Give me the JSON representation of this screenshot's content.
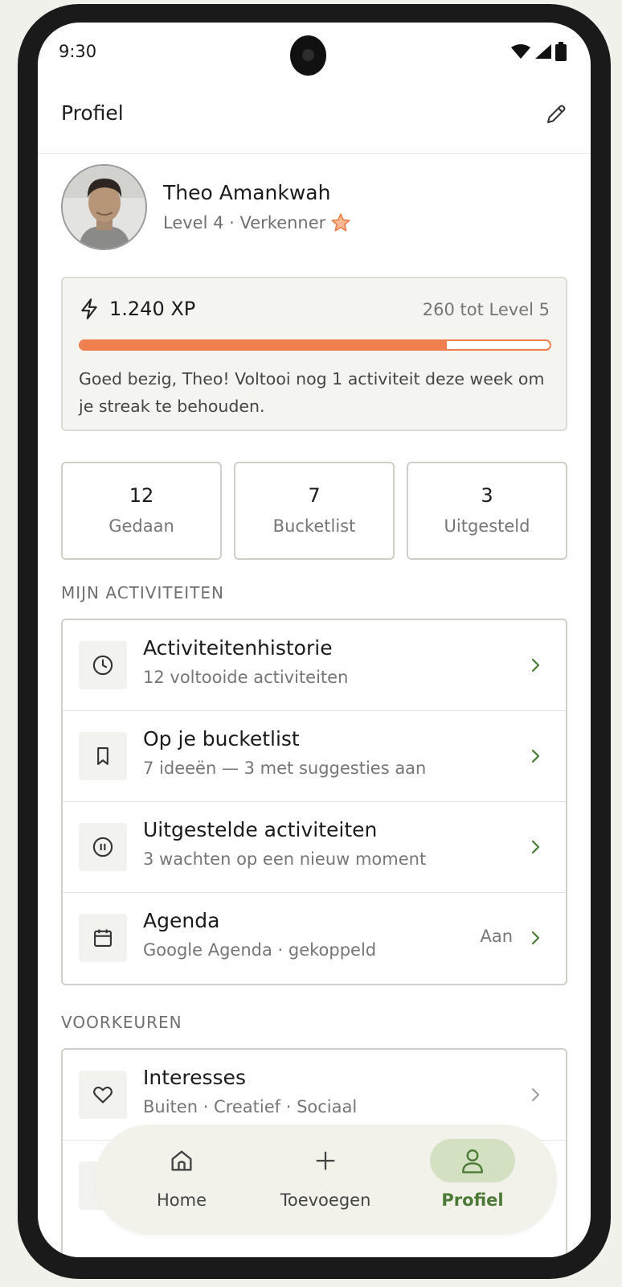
{
  "status_bar": {
    "time": "9:30"
  },
  "header": {
    "title": "Profiel",
    "edit_icon": "pencil-icon"
  },
  "profile": {
    "name": "Theo Amankwah",
    "level_text": "Level 4 · Verkenner",
    "badge_icon": "star-icon"
  },
  "xp": {
    "amount": "1.240 XP",
    "to_next": "260 tot Level 5",
    "progress_percent": 78,
    "message": "Goed bezig, Theo! Voltooi nog 1 activiteit deze week om je streak te behouden.",
    "accent_color": "#f07f4f"
  },
  "stats": [
    {
      "value": "12",
      "label": "Gedaan"
    },
    {
      "value": "7",
      "label": "Bucketlist"
    },
    {
      "value": "3",
      "label": "Uitgesteld"
    }
  ],
  "sections": {
    "activities_title": "MIJN ACTIVITEITEN",
    "preferences_title": "VOORKEUREN"
  },
  "activities": [
    {
      "icon": "clock-icon",
      "title": "Activiteitenhistorie",
      "subtitle": "12 voltooide activiteiten"
    },
    {
      "icon": "bookmark-icon",
      "title": "Op je bucketlist",
      "subtitle": "7 ideeën — 3 met suggesties aan"
    },
    {
      "icon": "pause-icon",
      "title": "Uitgestelde activiteiten",
      "subtitle": "3 wachten op een nieuw moment"
    },
    {
      "icon": "calendar-icon",
      "title": "Agenda",
      "subtitle": "Google Agenda · gekoppeld",
      "trailing": "Aan"
    }
  ],
  "preferences": [
    {
      "icon": "heart-icon",
      "title": "Interesses",
      "subtitle": "Buiten · Creatief · Sociaal"
    }
  ],
  "bottom_nav": {
    "items": [
      {
        "icon": "home-icon",
        "label": "Home"
      },
      {
        "icon": "plus-icon",
        "label": "Toevoegen"
      },
      {
        "icon": "person-icon",
        "label": "Profiel",
        "active": true
      }
    ],
    "active_color": "#4c7a36"
  }
}
